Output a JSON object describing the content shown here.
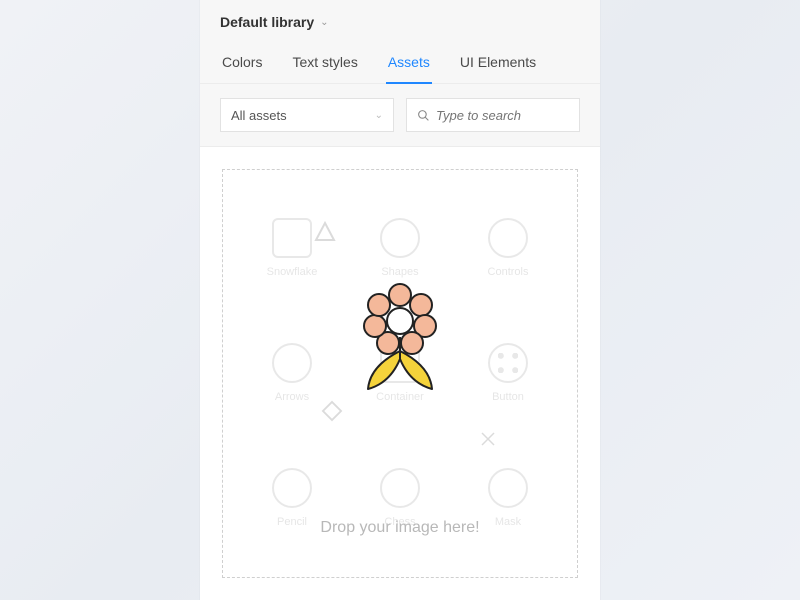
{
  "header": {
    "library_label": "Default library"
  },
  "tabs": {
    "colors": "Colors",
    "text_styles": "Text styles",
    "assets": "Assets",
    "ui_elements": "UI Elements",
    "active": "assets"
  },
  "filter": {
    "select_value": "All assets",
    "search_placeholder": "Type to search"
  },
  "dropzone": {
    "prompt": "Drop your image here!"
  },
  "ghost_items": {
    "a": "Snowflake",
    "b": "Shapes",
    "c": "Controls",
    "d": "Arrows",
    "e": "Container",
    "f": "Button",
    "g": "Pencil",
    "h": "Chess",
    "i": "Mask"
  }
}
